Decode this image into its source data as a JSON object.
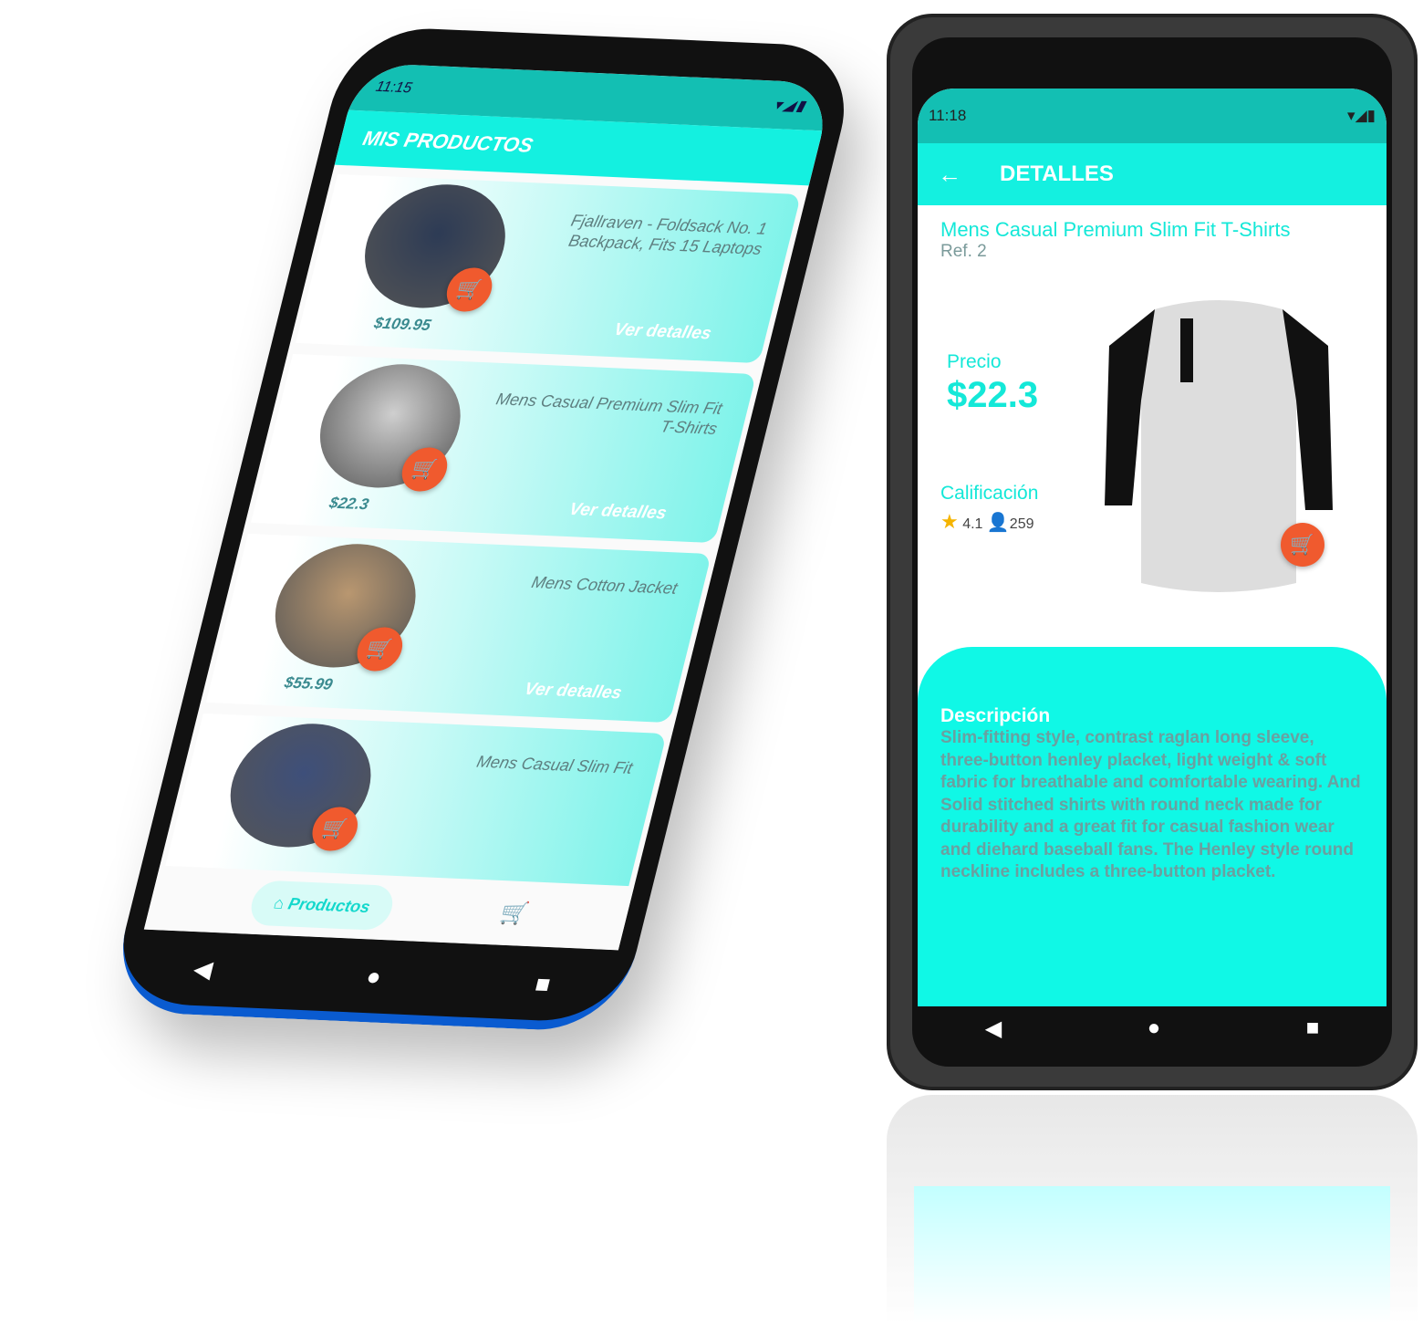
{
  "left_phone": {
    "status_time": "11:15",
    "title": "MIS PRODUCTOS",
    "products": [
      {
        "name": "Fjallraven - Foldsack No. 1 Backpack, Fits 15 Laptops",
        "price": "$109.95",
        "details": "Ver detalles",
        "color": "#2d3b55"
      },
      {
        "name": "Mens Casual Premium Slim Fit T-Shirts",
        "price": "$22.3",
        "details": "Ver detalles",
        "color": "#cfcfcf"
      },
      {
        "name": "Mens Cotton Jacket",
        "price": "$55.99",
        "details": "Ver detalles",
        "color": "#b99770"
      },
      {
        "name": "Mens Casual Slim Fit",
        "price": "",
        "details": "",
        "color": "#3e4f7a"
      }
    ],
    "nav": {
      "products": "Productos"
    }
  },
  "right_phone": {
    "status_time": "11:18",
    "title": "DETALLES",
    "product_name": "Mens Casual Premium Slim Fit T-Shirts",
    "ref": "Ref. 2",
    "price_label": "Precio",
    "price": "$22.3",
    "rating_label": "Calificación",
    "rating": "4.1",
    "rating_count": "259",
    "desc_label": "Descripción",
    "description": "Slim-fitting style, contrast raglan long sleeve, three-button henley placket, light weight & soft fabric for breathable and comfortable wearing. And Solid stitched shirts with round neck made for durability and a great fit for casual fashion wear and diehard baseball fans. The Henley style round neckline includes a three-button placket."
  }
}
